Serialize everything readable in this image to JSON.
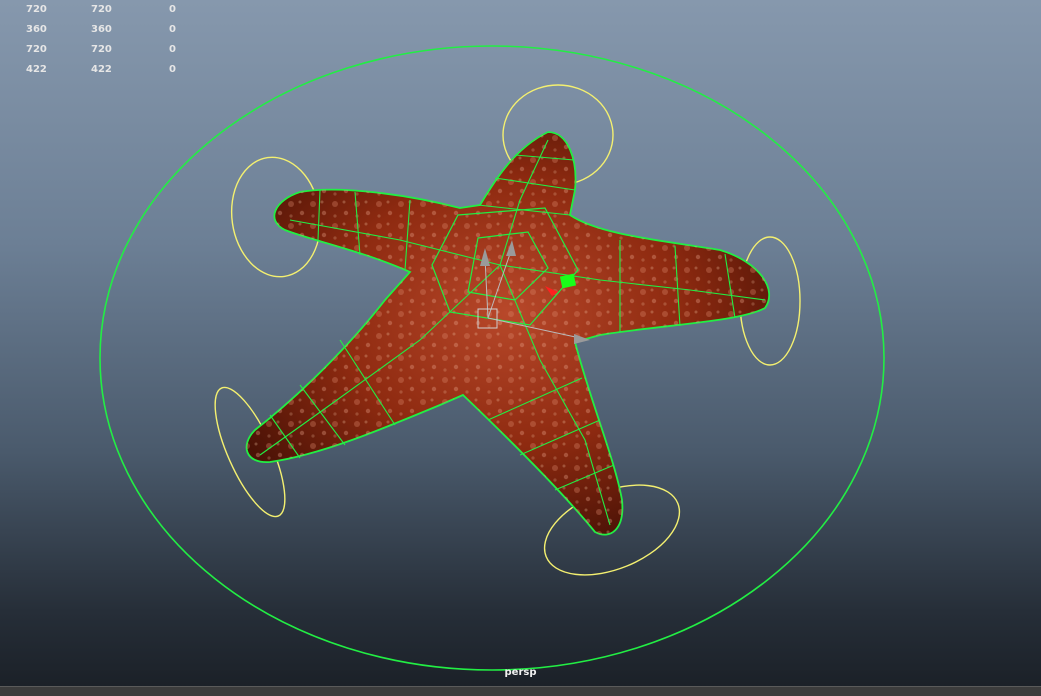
{
  "viewport": {
    "camera_label": "persp",
    "hud_rows": [
      [
        "720",
        "720",
        "0"
      ],
      [
        "360",
        "360",
        "0"
      ],
      [
        "720",
        "720",
        "0"
      ],
      [
        "422",
        "422",
        "0"
      ]
    ]
  },
  "colors": {
    "wireframe": "#22ee44",
    "control_curves": "#f4f070",
    "starfish_base": "#8e2a10",
    "starfish_dark": "#4a1206",
    "starfish_light": "#c0502a",
    "selected_handle": "#19ff19",
    "manipulator": "#9a9a9a"
  }
}
